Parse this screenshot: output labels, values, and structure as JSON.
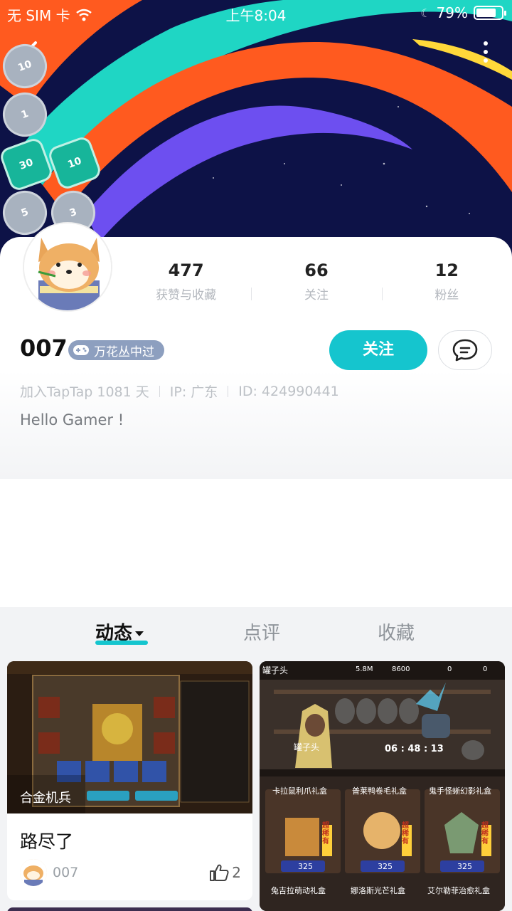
{
  "status_bar": {
    "carrier": "无 SIM 卡",
    "time": "上午8:04",
    "battery": "79%",
    "battery_level": 0.79
  },
  "badges": [
    "10",
    "1",
    "30",
    "10",
    "5",
    "3"
  ],
  "profile": {
    "username": "007",
    "title_tag": "万花丛中过",
    "follow_label": "关注",
    "stats": [
      {
        "num": "477",
        "label": "获赞与收藏"
      },
      {
        "num": "66",
        "label": "关注"
      },
      {
        "num": "12",
        "label": "粉丝"
      }
    ],
    "meta": {
      "joined": "加入TapTap 1081 天",
      "ip": "IP: 广东",
      "id": "ID: 424990441"
    },
    "bio": "Hello Gamer !"
  },
  "tabs": [
    {
      "label": "动态"
    },
    {
      "label": "点评"
    },
    {
      "label": "收藏"
    }
  ],
  "feed": {
    "post1": {
      "thumb_label": "合金机兵",
      "title": "路尽了",
      "author": "007",
      "likes": "2"
    },
    "post2": {
      "name": "罐子头",
      "coins": "5.8M",
      "gems": "8600",
      "cards1": "0",
      "cards2": "0",
      "jar_label": "罐子头",
      "timer": "06 : 48 : 13",
      "boxes": [
        {
          "name": "卡拉鼠利爪礼盒",
          "price": "325",
          "tag": "超稀有"
        },
        {
          "name": "普莱鸭卷毛礼盒",
          "price": "325",
          "tag": "超稀有"
        },
        {
          "name": "鬼手怪蜥幻影礼盒",
          "price": "325",
          "tag": "超稀有"
        }
      ],
      "boxes_row2": [
        "兔吉拉萌动礼盒",
        "娜洛斯光芒礼盒",
        "艾尔勒菲治愈礼盒"
      ]
    }
  },
  "colors": {
    "accent": "#15c5ce",
    "banner_bg": "#0d1247",
    "stripe_teal": "#1fd6c4",
    "stripe_orange": "#ff5a1f",
    "stripe_purple": "#6d4ff0",
    "stripe_yellow": "#ffd83a"
  }
}
